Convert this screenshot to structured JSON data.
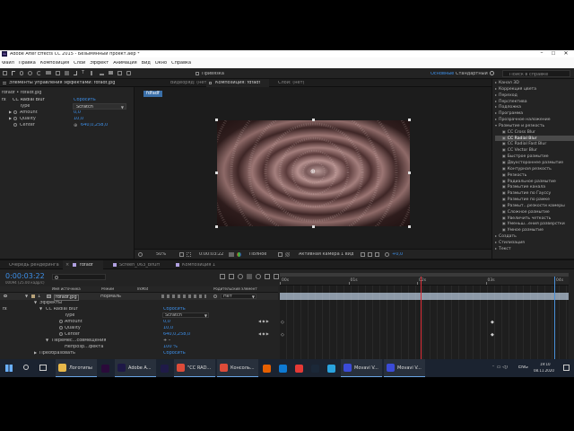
{
  "window": {
    "title": "Adobe After Effects CC 2015 - Безымянный проект.aep *"
  },
  "menu": [
    "Файл",
    "Правка",
    "Композиция",
    "Слой",
    "Эффект",
    "Анимация",
    "Вид",
    "Окно",
    "Справка"
  ],
  "toolbar": {
    "snap_label": "Привязка",
    "workspace_label": "Основные",
    "standard_label": "Стандартный",
    "search_placeholder": "Поиск в справке"
  },
  "effects_panel": {
    "tab": "Элементы управления эффектами: fdfadf.jpg",
    "layer_path": "fdfadf • fdfadf.jpg",
    "effect_name": "CC Radial Blur",
    "reset_label": "Сбросить",
    "props": [
      {
        "name": "Type",
        "value": "Scratch"
      },
      {
        "name": "Amount",
        "value": "0,0"
      },
      {
        "name": "Quality",
        "value": "10,0"
      },
      {
        "name": "Center",
        "value": "640,0,258,0"
      }
    ]
  },
  "viewer": {
    "tabs": [
      "Видеоряд: (нет)",
      "Композиция: fdfadf",
      "Слой: (нет)"
    ],
    "breadcrumb": "fdfadf",
    "zoom": "50%",
    "timecode": "0:00:03:22",
    "resolution": "Полное",
    "camera": "Активная камера",
    "views": "1 вид",
    "exposure": "+0,0"
  },
  "effects_list": {
    "items": [
      {
        "label": "Канал 3D",
        "type": "folder"
      },
      {
        "label": "Коррекция цвета",
        "type": "folder"
      },
      {
        "label": "Переход",
        "type": "folder"
      },
      {
        "label": "Перспектива",
        "type": "folder"
      },
      {
        "label": "Подложка",
        "type": "folder"
      },
      {
        "label": "Программа",
        "type": "folder"
      },
      {
        "label": "Прозрачное наложение",
        "type": "folder"
      },
      {
        "label": "Размытие и резкость",
        "type": "folder-open"
      },
      {
        "label": "CC Cross Blur",
        "type": "effect"
      },
      {
        "label": "CC Radial Blur",
        "type": "effect-selected"
      },
      {
        "label": "CC Radial Fast Blur",
        "type": "effect"
      },
      {
        "label": "CC Vector Blur",
        "type": "effect"
      },
      {
        "label": "Быстрое размытие",
        "type": "effect"
      },
      {
        "label": "Двухстороннее размытие",
        "type": "effect"
      },
      {
        "label": "Контурная резкость",
        "type": "effect"
      },
      {
        "label": "Резкость",
        "type": "effect"
      },
      {
        "label": "Радиальное размытие",
        "type": "effect"
      },
      {
        "label": "Размытие канала",
        "type": "effect"
      },
      {
        "label": "Размытие по Гауссу",
        "type": "effect"
      },
      {
        "label": "Размытие по рамке",
        "type": "effect"
      },
      {
        "label": "Размыт...резкости камеры",
        "type": "effect"
      },
      {
        "label": "Сложное размытие",
        "type": "effect"
      },
      {
        "label": "Увеличить четкость",
        "type": "effect"
      },
      {
        "label": "Уменьш...ения разверстки",
        "type": "effect"
      },
      {
        "label": "Умное размытие",
        "type": "effect"
      },
      {
        "label": "Создать",
        "type": "folder"
      },
      {
        "label": "Стилизация",
        "type": "folder"
      },
      {
        "label": "Текст",
        "type": "folder"
      }
    ]
  },
  "timeline": {
    "tabs": [
      "Очередь рендеринга",
      "fdfadf",
      "Scrеen_063_bifurf",
      "Композиция 1"
    ],
    "timecode": "0:00:03:22",
    "frame_info": "00094 (25.00 кадр/с)",
    "column_headers": [
      "Имя источника",
      "Режим",
      "TrkMat",
      "Родительский элемент"
    ],
    "layer": {
      "index": "1",
      "name": "fdfadf.jpg",
      "mode": "Нормаль",
      "parent": "Нет"
    },
    "rows": [
      {
        "label": "Эффекты",
        "value": ""
      },
      {
        "label": "CC Radial Blur",
        "value": "Сбросить"
      },
      {
        "label": "Type",
        "value": "Scratch"
      },
      {
        "label": "Amount",
        "value": "0,0"
      },
      {
        "label": "Quality",
        "value": "10,0"
      },
      {
        "label": "Center",
        "value": "640,0,258,0"
      },
      {
        "label": "Перемес...совмещения",
        "value": "+ –"
      },
      {
        "label": "Непрозр...фекта",
        "value": "100 %"
      },
      {
        "label": "Преобразовать",
        "value": "Сбросить"
      }
    ],
    "ruler_labels": [
      "00s",
      "01s",
      "02s",
      "03s",
      "04s"
    ],
    "playhead_seconds": 3.88,
    "duration_seconds": 10
  },
  "taskbar": {
    "apps": [
      {
        "label": "Логотипы",
        "icon": "folder-icon",
        "color": "#e8b84a"
      },
      {
        "label": "",
        "icon": "premiere-icon",
        "color": "#2a0a3a"
      },
      {
        "label": "Adobe A...",
        "icon": "after-effects-icon",
        "color": "#1e1846"
      },
      {
        "label": "",
        "icon": "media-encoder-icon",
        "color": "#1f1a48"
      },
      {
        "label": "\"CC RAD...",
        "icon": "chrome-icon",
        "color": "#dd4b39"
      },
      {
        "label": "Консоль...",
        "icon": "chrome-icon",
        "color": "#dd4b39"
      },
      {
        "label": "",
        "icon": "firefox-icon",
        "color": "#e66000"
      },
      {
        "label": "",
        "icon": "edge-icon",
        "color": "#0e7ad3"
      },
      {
        "label": "",
        "icon": "yandex-icon",
        "color": "#e53935"
      },
      {
        "label": "",
        "icon": "steam-icon",
        "color": "#1b2838"
      },
      {
        "label": "",
        "icon": "telegram-icon",
        "color": "#2aa3de"
      },
      {
        "label": "Movavi V...",
        "icon": "movavi-icon",
        "color": "#3b4bd8"
      },
      {
        "label": "Movavi V...",
        "icon": "movavi-icon",
        "color": "#3b4bd8"
      }
    ],
    "lang": "ENG",
    "time": "19:10",
    "date": "08.11.2020"
  }
}
